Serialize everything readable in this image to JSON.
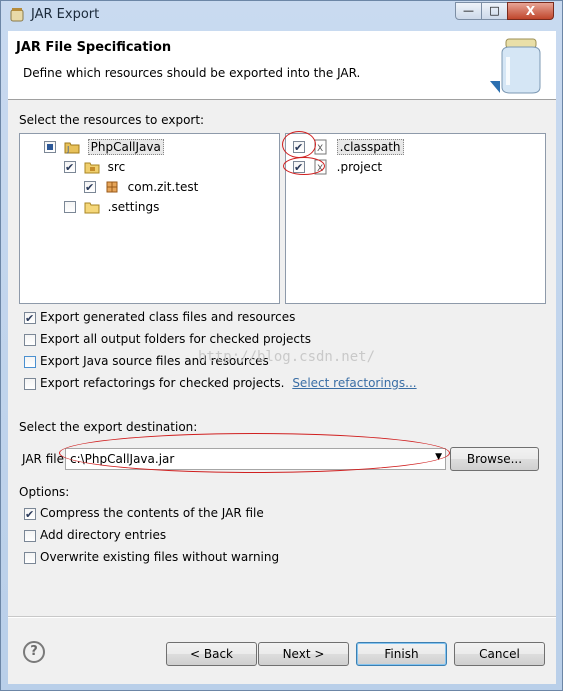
{
  "window": {
    "title": "JAR Export",
    "close_glyph": "X",
    "min_glyph": "—",
    "max_glyph": "□"
  },
  "banner": {
    "title": "JAR File Specification",
    "description": "Define which resources should be exported into the JAR.",
    "icon": "jar-icon"
  },
  "resources": {
    "label": "Select the resources to export:",
    "tree": [
      {
        "label": "PhpCallJava",
        "state": "partial",
        "icon": "java-project-icon"
      },
      {
        "label": "src",
        "state": "checked",
        "icon": "source-folder-icon"
      },
      {
        "label": "com.zit.test",
        "state": "checked",
        "icon": "package-icon"
      },
      {
        "label": ".settings",
        "state": "unchecked",
        "icon": "folder-icon"
      }
    ],
    "files": [
      {
        "label": ".classpath",
        "state": "checked",
        "icon": "xml-file-icon"
      },
      {
        "label": ".project",
        "state": "checked",
        "icon": "xml-file-icon"
      }
    ]
  },
  "options_top": [
    {
      "label": "Export generated class files and resources",
      "checked": true
    },
    {
      "label": "Export all output folders for checked projects",
      "checked": false
    },
    {
      "label": "Export Java source files and resources",
      "checked": false
    },
    {
      "label": "Export refactorings for checked projects.",
      "checked": false,
      "link": "Select refactorings..."
    }
  ],
  "destination": {
    "label": "Select the export destination:",
    "jar_label": "JAR file:",
    "jar_value": "c:\\PhpCallJava.jar",
    "browse": "Browse..."
  },
  "options": {
    "label": "Options:",
    "items": [
      {
        "label": "Compress the contents of the JAR file",
        "checked": true
      },
      {
        "label": "Add directory entries",
        "checked": false
      },
      {
        "label": "Overwrite existing files without warning",
        "checked": false
      }
    ]
  },
  "watermark": "http://blog.csdn.net/",
  "buttons": {
    "help": "?",
    "back": "< Back",
    "next": "Next >",
    "finish": "Finish",
    "cancel": "Cancel"
  }
}
